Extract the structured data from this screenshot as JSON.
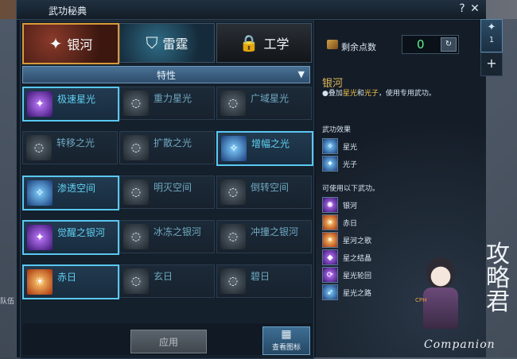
{
  "background": {
    "left_chip": "队伍"
  },
  "window": {
    "title": "武功秘典",
    "help_label": "?",
    "close_label": "✕"
  },
  "tabs": [
    {
      "label": "银河",
      "icon": "galaxy-icon"
    },
    {
      "label": "雷霆",
      "icon": "thunder-shield-icon"
    },
    {
      "label": "工学",
      "icon": "lock-icon"
    }
  ],
  "filter": {
    "selected": "特性"
  },
  "skills": [
    {
      "name": "极速星光",
      "active": true,
      "icon": "purple-star-icon"
    },
    {
      "name": "重力星光",
      "active": false,
      "icon": "grey-star-icon"
    },
    {
      "name": "广域星光",
      "active": false,
      "icon": "grey-star-icon"
    },
    {
      "name": "转移之光",
      "active": false,
      "icon": "grey-light-icon"
    },
    {
      "name": "扩散之光",
      "active": false,
      "icon": "grey-light-icon"
    },
    {
      "name": "增幅之光",
      "active": true,
      "icon": "blue-light-icon"
    },
    {
      "name": "渗透空间",
      "active": true,
      "icon": "blue-space-icon"
    },
    {
      "name": "明灭空间",
      "active": false,
      "icon": "grey-space-icon"
    },
    {
      "name": "倒转空间",
      "active": false,
      "icon": "grey-space-icon"
    },
    {
      "name": "觉醒之银河",
      "active": true,
      "icon": "purple-galaxy-icon"
    },
    {
      "name": "冰冻之银河",
      "active": false,
      "icon": "grey-galaxy-icon"
    },
    {
      "name": "冲撞之银河",
      "active": false,
      "icon": "grey-galaxy-icon"
    },
    {
      "name": "赤日",
      "active": true,
      "icon": "orange-sun-icon"
    },
    {
      "name": "玄日",
      "active": false,
      "icon": "grey-sun-icon"
    },
    {
      "name": "碧日",
      "active": false,
      "icon": "grey-sun-icon"
    }
  ],
  "actions": {
    "apply": "应用",
    "view_icon": "查看图标"
  },
  "points": {
    "label": "剩余点数",
    "value": "0"
  },
  "side_tabs": {
    "tab1": "1",
    "plus": "+"
  },
  "detail": {
    "title": "银河",
    "desc_pre": "●叠加",
    "desc_hl1": "星光",
    "desc_mid": "和",
    "desc_hl2": "光子",
    "desc_post": "，使用专用武功。",
    "effects_title": "武功效果",
    "effects": [
      "星光",
      "光子"
    ],
    "usable_title": "可使用以下武功。",
    "usable": [
      "银河",
      "赤日",
      "星河之歌",
      "星之结晶",
      "星光轮回",
      "星光之路"
    ]
  },
  "watermark": {
    "brand": "Companion",
    "calligraphy": "攻略君",
    "badge": "CPH"
  },
  "colors": {
    "accent": "#5ac8f2",
    "gold": "#e0b85a",
    "points_green": "#5ef090"
  }
}
